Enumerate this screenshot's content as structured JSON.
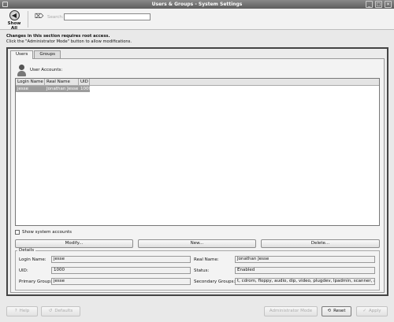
{
  "window": {
    "title": "Users & Groups - System Settings",
    "close_glyph": "×",
    "max_glyph": "□",
    "min_glyph": "_"
  },
  "toolbar": {
    "show_all_label": "Show All",
    "search_label": "Search:",
    "search_value": ""
  },
  "notice": {
    "line1": "Changes in this section requires root access.",
    "line2": "Click the \"Administrator Mode\" button to allow modifications."
  },
  "tabs": [
    {
      "label": "Users"
    },
    {
      "label": "Groups"
    }
  ],
  "users": {
    "section_label": "User Accounts:",
    "columns": [
      "Login Name",
      "Real Name",
      "UID"
    ],
    "rows": [
      {
        "login": "jesse",
        "real_name": "Jonathan Jesse",
        "uid": "1000"
      }
    ],
    "show_system_accounts_label": "Show system accounts",
    "modify_label": "Modify...",
    "new_label": "New...",
    "delete_label": "Delete..."
  },
  "details": {
    "legend": "Details",
    "login_name_label": "Login Name:",
    "login_name_value": "jesse",
    "real_name_label": "Real Name:",
    "real_name_value": "Jonathan Jesse",
    "uid_label": "UID:",
    "uid_value": "1000",
    "status_label": "Status:",
    "status_value": "Enabled",
    "primary_group_label": "Primary Group:",
    "primary_group_value": "jesse",
    "secondary_groups_label": "Secondary Groups:",
    "secondary_groups_value": "t, cdrom, floppy, audio, dip, video, plugdev, lpadmin, scanner, admin"
  },
  "bottom": {
    "help_label": "Help",
    "defaults_label": "Defaults",
    "admin_mode_label": "Administrator Mode",
    "reset_label": "Reset",
    "apply_label": "Apply"
  }
}
